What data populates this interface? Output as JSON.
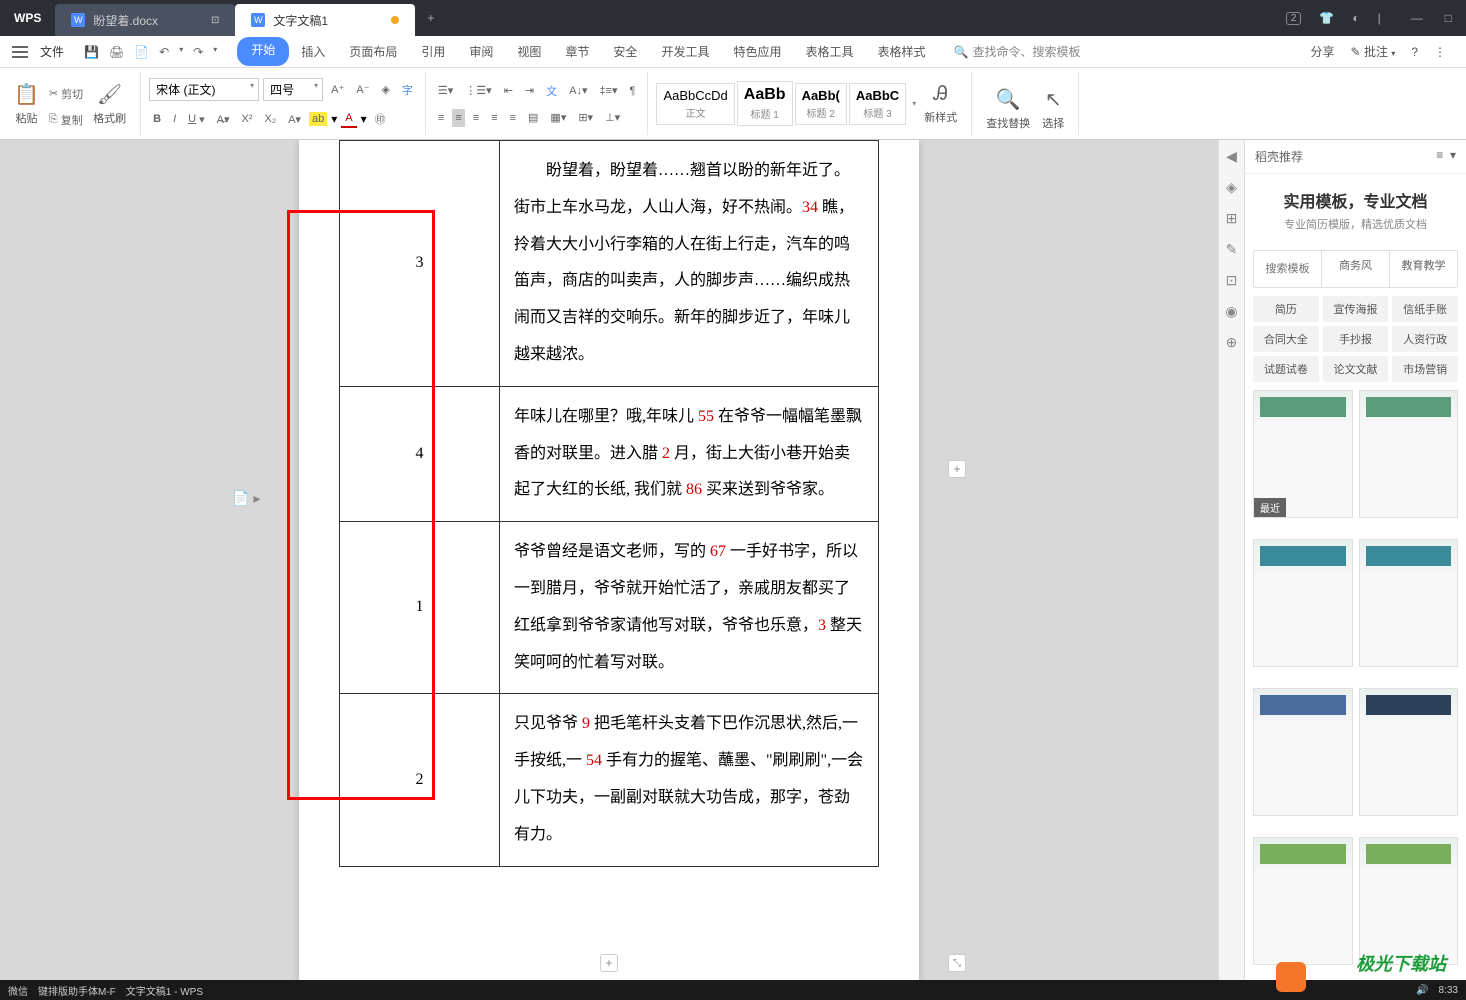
{
  "titlebar": {
    "logo": "WPS",
    "tabs": [
      {
        "label": "盼望着.docx",
        "active": false
      },
      {
        "label": "文字文稿1",
        "active": true
      }
    ]
  },
  "menubar": {
    "file": "文件",
    "tabs": [
      "开始",
      "插入",
      "页面布局",
      "引用",
      "审阅",
      "视图",
      "章节",
      "安全",
      "开发工具",
      "特色应用",
      "表格工具",
      "表格样式"
    ],
    "active_tab": 0,
    "search_placeholder": "查找命令、搜索模板",
    "share": "分享",
    "comment": "批注"
  },
  "ribbon": {
    "paste": "粘贴",
    "cut": "剪切",
    "copy": "复制",
    "format_painter": "格式刷",
    "font_name": "宋体 (正文)",
    "font_size": "四号",
    "styles": [
      {
        "preview": "AaBbCcDd",
        "label": "正文"
      },
      {
        "preview": "AaBb",
        "label": "标题 1"
      },
      {
        "preview": "AaBb(",
        "label": "标题 2"
      },
      {
        "preview": "AaBbC",
        "label": "标题 3"
      }
    ],
    "new_style": "新样式",
    "find_replace": "查找替换",
    "select": "选择"
  },
  "document": {
    "rows": [
      {
        "num": "3",
        "text_parts": [
          "盼望着，盼望着……翘首以盼的新年近了。街市上车水马龙，人山人海，好不热闹。",
          "34",
          " 瞧，拎着大大小小行李箱的人在街上行走，汽车的鸣笛声，商店的叫卖声，人的脚步声……编织成热闹而又吉祥的交响乐。新年的脚步近了，年味儿越来越浓。"
        ]
      },
      {
        "num": "4",
        "text_parts": [
          "年味儿在哪里？哦,年味儿 ",
          "55",
          " 在爷爷一幅幅笔墨飘香的对联里。进入腊 ",
          "2",
          " 月，街上大街小巷开始卖起了大红的长纸, 我们就 ",
          "86",
          " 买来送到爷爷家。"
        ]
      },
      {
        "num": "1",
        "text_parts": [
          "爷爷曾经是语文老师，写的 ",
          "67",
          " 一手好书字，所以一到腊月，爷爷就开始忙活了，亲戚朋友都买了红纸拿到爷爷家请他写对联，爷爷也乐意，",
          "3",
          " 整天笑呵呵的忙着写对联。"
        ]
      },
      {
        "num": "2",
        "text_parts": [
          "只见爷爷 ",
          "9",
          " 把毛笔杆头支着下巴作沉思状,然后,一手按纸,一 ",
          "54",
          " 手有力的握笔、蘸墨、\"刷刷刷\",一会儿下功夫，一副副对联就大功告成，那字，苍劲有力。"
        ]
      }
    ]
  },
  "panel": {
    "header": "稻壳推荐",
    "hero_title": "实用模板，专业文档",
    "hero_sub": "专业简历模版，精选优质文档",
    "top_tabs": [
      "搜索模板",
      "商务风",
      "教育教学"
    ],
    "tags": [
      "简历",
      "宣传海报",
      "信纸手账",
      "合同大全",
      "手抄报",
      "人资行政",
      "试题试卷",
      "论文文献",
      "市场营销"
    ],
    "recent": "最近"
  },
  "taskbar": {
    "app1": "微信",
    "app2": "键排版助手体M-F",
    "app3": "文字文稿1 - WPS",
    "time": "8:33"
  },
  "watermark": "极光下载站"
}
